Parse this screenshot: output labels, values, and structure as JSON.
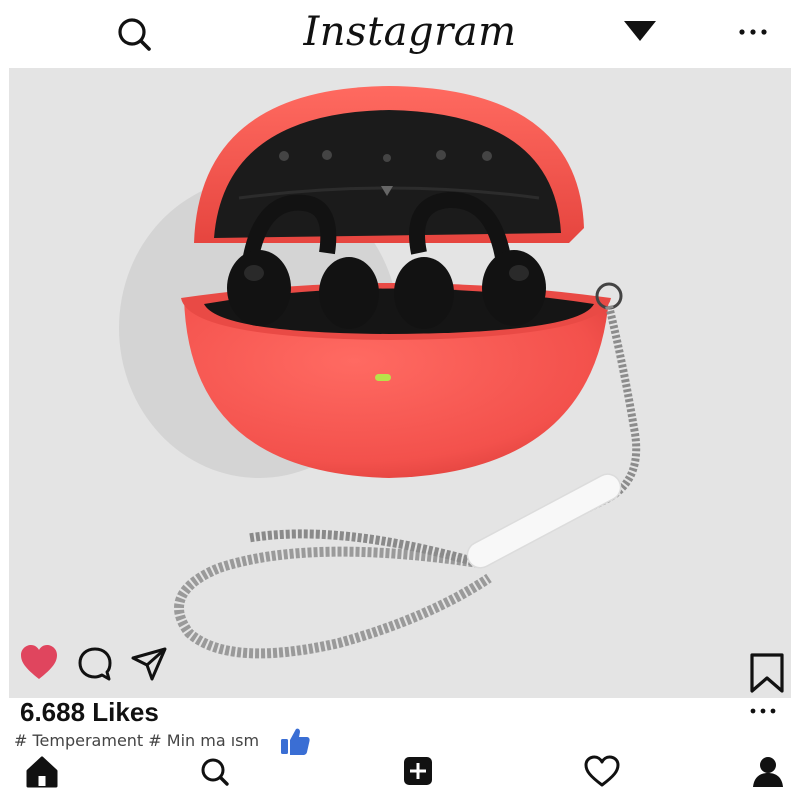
{
  "header": {
    "logo_text": "Instagram",
    "icons": [
      "search-icon",
      "triangle-down-icon",
      "more-icon"
    ]
  },
  "post": {
    "image_subject": "red earbud case with black open-ear earbuds and grey braided lanyard",
    "likes_text": "6.688 Likes",
    "caption": "# Temperament # Min ma ısm",
    "liked": true,
    "colors": {
      "heart": "#e0455e",
      "case": "#f3514c",
      "thumb": "#3a6ed4",
      "background": "#e4e4e4"
    }
  },
  "actions": [
    "heart-icon",
    "comment-icon",
    "send-icon",
    "bookmark-icon"
  ],
  "bottom_nav": [
    "home-icon",
    "search-icon",
    "add-post-icon",
    "heart-icon",
    "profile-icon"
  ]
}
